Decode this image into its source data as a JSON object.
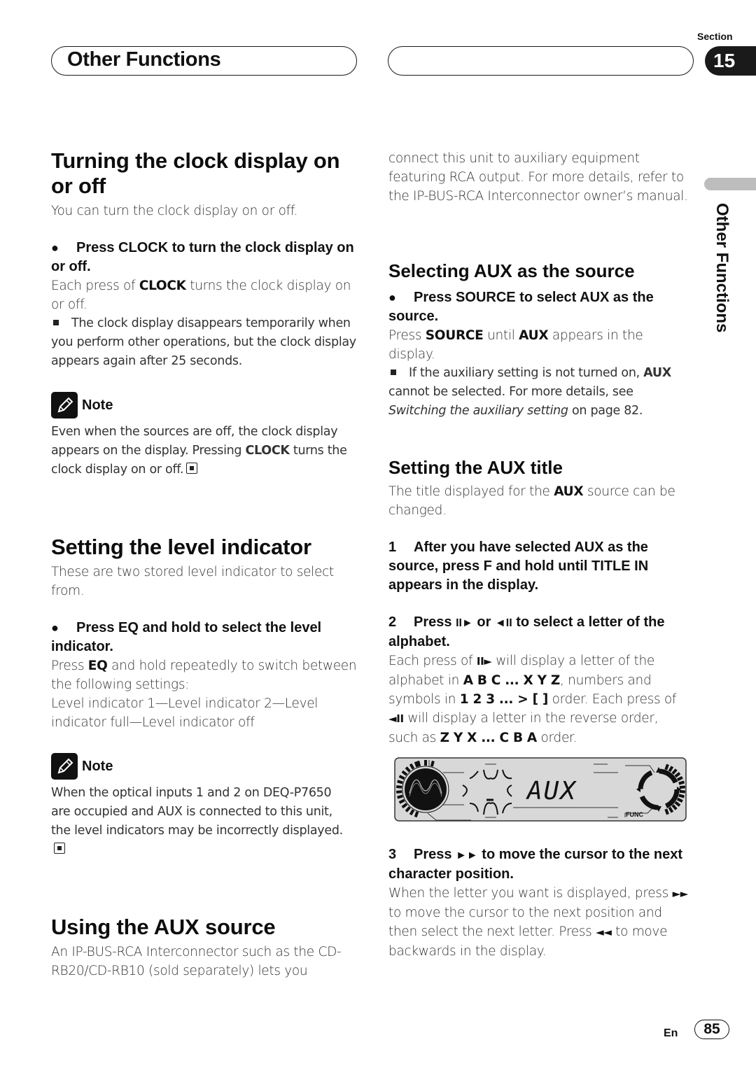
{
  "header": {
    "title": "Other Functions",
    "section_label": "Section",
    "section_number": "15"
  },
  "side_tab": {
    "label": "Other Functions"
  },
  "left": {
    "clock": {
      "heading": "Turning the clock display on or off",
      "intro": "You can turn the clock display on or off.",
      "step": "Press CLOCK to turn the clock display on or off.",
      "body_pre": "Each press of ",
      "body_bold": "CLOCK",
      "body_post": " turns the clock display on or off.",
      "tip": "The clock display disappears temporarily when you perform other operations, but the clock display appears again after 25 seconds.",
      "note_label": "Note",
      "note_pre": "Even when the sources are off, the clock display appears on the display. Pressing ",
      "note_bold": "CLOCK",
      "note_post": " turns the clock display on or off."
    },
    "level": {
      "heading": "Setting the level indicator",
      "intro": "These are two stored level indicator to select from.",
      "step": "Press EQ and hold to select the level indicator.",
      "body_pre": "Press ",
      "body_bold": "EQ",
      "body_post": " and hold repeatedly to switch between the following settings:",
      "sequence": "Level indicator 1—Level indicator 2—Level indicator full—Level indicator off",
      "note_label": "Note",
      "note": "When the optical inputs 1 and 2 on DEQ-P7650 are occupied and AUX is connected to this unit, the level indicators may be incorrectly displayed."
    },
    "aux": {
      "heading": "Using the AUX source",
      "intro_left": "An IP-BUS-RCA Interconnector such as the CD-RB20/CD-RB10 (sold separately) lets you"
    }
  },
  "right": {
    "aux_continued": "connect this unit to auxiliary equipment featuring RCA output. For more details, refer to the IP-BUS-RCA Interconnector owner’s manual.",
    "select": {
      "heading": "Selecting AUX as the source",
      "step": "Press SOURCE to select AUX as the source.",
      "body_1": "Press ",
      "body_b1": "SOURCE",
      "body_2": " until ",
      "body_b2": "AUX",
      "body_3": " appears in the display.",
      "tip_1": "If the auxiliary setting is not turned on, ",
      "tip_b": "AUX",
      "tip_2": " cannot be selected. For more details, see ",
      "tip_i": "Switching the auxiliary setting",
      "tip_3": " on page 82."
    },
    "title": {
      "heading": "Setting the AUX title",
      "intro_1": "The title displayed for the ",
      "intro_b": "AUX",
      "intro_2": " source can be changed.",
      "step1_num": "1",
      "step1": "After you have selected AUX as the source, press F and hold until TITLE IN appears in the display.",
      "step2_num": "2",
      "step2_a": "Press ",
      "step2_sym1": "II►",
      "step2_b": " or ",
      "step2_sym2": "◄II",
      "step2_c": " to select a letter of the alphabet.",
      "step2_body_1": "Each press of ",
      "step2_body_sym1": "II►",
      "step2_body_2": " will display a letter of the alphabet in ",
      "step2_body_b1": "A B C ... X Y Z",
      "step2_body_3": ", numbers and symbols in ",
      "step2_body_b2": "1 2 3 ... > [ ]",
      "step2_body_4": " order. Each press of ",
      "step2_body_sym2": "◄II",
      "step2_body_5": " will display a letter in the reverse order, such as ",
      "step2_body_b3": "Z Y X ... C B A",
      "step2_body_6": " order.",
      "display_text": "AUX",
      "display_func": "FUNC",
      "step3_num": "3",
      "step3_a": "Press ",
      "step3_sym": "►►",
      "step3_b": " to move the cursor to the next character position.",
      "step3_body_1": "When the letter you want is displayed, press ",
      "step3_body_sym1": "►►",
      "step3_body_2": " to move the cursor to the next position and then select the next letter. Press ",
      "step3_body_sym2": "◄◄",
      "step3_body_3": " to move backwards in the display."
    }
  },
  "footer": {
    "lang": "En",
    "page": "85"
  }
}
